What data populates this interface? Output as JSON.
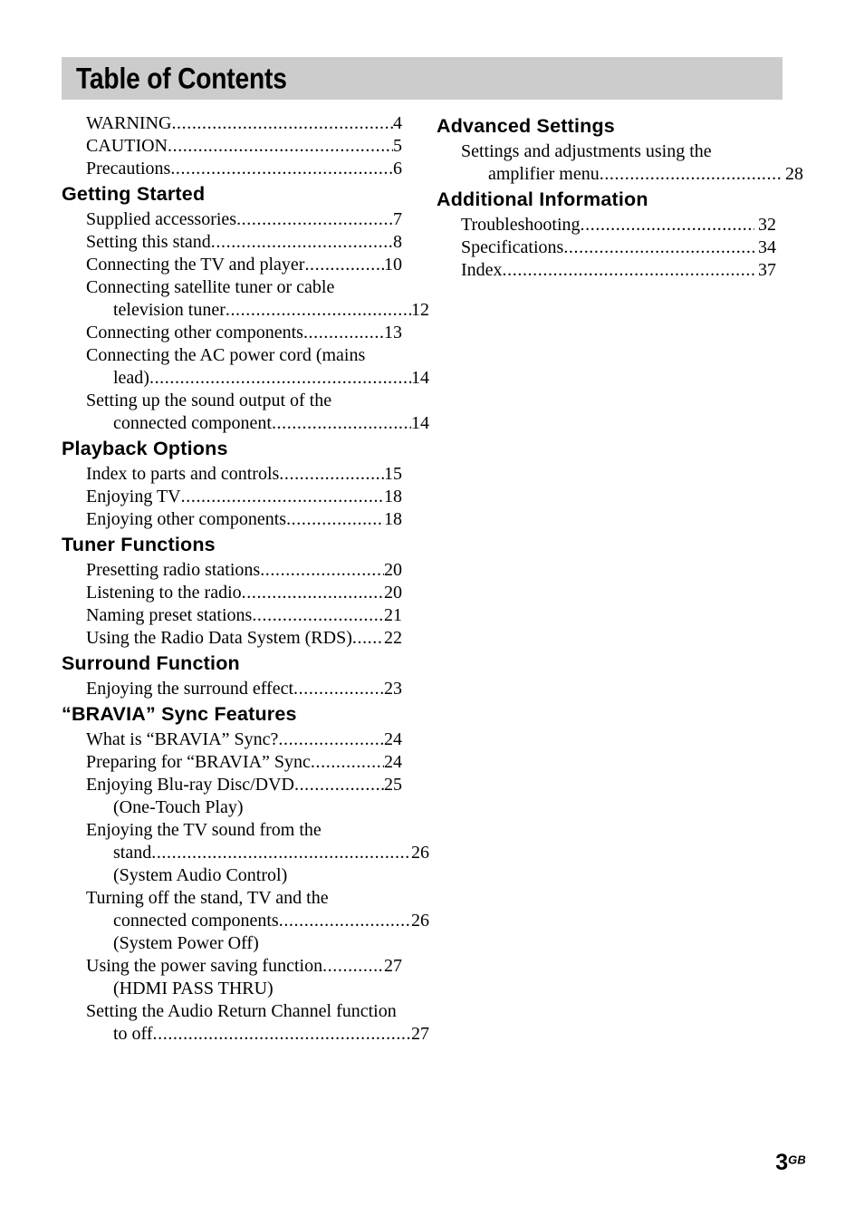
{
  "header": {
    "title": "Table of Contents",
    "banner_color": "#cccccc"
  },
  "footer": {
    "page_number": "3",
    "region_suffix": "GB"
  },
  "left_column": {
    "blocks": [
      {
        "type": "entries",
        "entries": [
          {
            "lines": [
              {
                "text": "WARNING",
                "leader": true,
                "page": "4"
              }
            ]
          },
          {
            "lines": [
              {
                "text": "CAUTION",
                "leader": true,
                "page": "5"
              }
            ]
          },
          {
            "lines": [
              {
                "text": "Precautions",
                "leader": true,
                "page": "6"
              }
            ]
          }
        ]
      },
      {
        "type": "heading",
        "label": "Getting Started"
      },
      {
        "type": "entries",
        "entries": [
          {
            "lines": [
              {
                "text": "Supplied accessories",
                "leader": true,
                "page": "7"
              }
            ]
          },
          {
            "lines": [
              {
                "text": "Setting this stand",
                "leader": true,
                "page": "8"
              }
            ]
          },
          {
            "lines": [
              {
                "text": "Connecting the TV and player",
                "leader": true,
                "page": "10"
              }
            ]
          },
          {
            "lines": [
              {
                "text": "Connecting satellite tuner or cable",
                "leader": false,
                "page": ""
              },
              {
                "text": "television tuner",
                "leader": true,
                "page": "12",
                "wrap": true
              }
            ]
          },
          {
            "lines": [
              {
                "text": "Connecting other components",
                "leader": true,
                "page": "13"
              }
            ]
          },
          {
            "lines": [
              {
                "text": "Connecting the AC power cord (mains",
                "leader": false,
                "page": ""
              },
              {
                "text": "lead)",
                "leader": true,
                "page": "14",
                "wrap": true
              }
            ]
          },
          {
            "lines": [
              {
                "text": "Setting up the sound output of the",
                "leader": false,
                "page": ""
              },
              {
                "text": "connected component",
                "leader": true,
                "page": "14",
                "wrap": true
              }
            ]
          }
        ]
      },
      {
        "type": "heading",
        "label": "Playback Options"
      },
      {
        "type": "entries",
        "entries": [
          {
            "lines": [
              {
                "text": "Index to parts and controls",
                "leader": true,
                "page": "15"
              }
            ]
          },
          {
            "lines": [
              {
                "text": "Enjoying TV",
                "leader": true,
                "page": "18"
              }
            ]
          },
          {
            "lines": [
              {
                "text": "Enjoying other components",
                "leader": true,
                "page": "18"
              }
            ]
          }
        ]
      },
      {
        "type": "heading",
        "label": "Tuner Functions"
      },
      {
        "type": "entries",
        "entries": [
          {
            "lines": [
              {
                "text": "Presetting radio stations",
                "leader": true,
                "page": "20"
              }
            ]
          },
          {
            "lines": [
              {
                "text": "Listening to the radio",
                "leader": true,
                "page": "20"
              }
            ]
          },
          {
            "lines": [
              {
                "text": "Naming preset stations",
                "leader": true,
                "page": "21"
              }
            ]
          },
          {
            "lines": [
              {
                "text": "Using the Radio Data System (RDS)",
                "leader": true,
                "page": "22"
              }
            ]
          }
        ]
      },
      {
        "type": "heading",
        "label": "Surround Function"
      },
      {
        "type": "entries",
        "entries": [
          {
            "lines": [
              {
                "text": "Enjoying the surround effect",
                "leader": true,
                "page": "23"
              }
            ]
          }
        ]
      },
      {
        "type": "heading",
        "label": "“BRAVIA” Sync Features"
      },
      {
        "type": "entries",
        "entries": [
          {
            "lines": [
              {
                "text": "What is “BRAVIA” Sync?",
                "leader": true,
                "page": "24"
              }
            ]
          },
          {
            "lines": [
              {
                "text": "Preparing for “BRAVIA” Sync",
                "leader": true,
                "page": "24"
              }
            ]
          },
          {
            "lines": [
              {
                "text": "Enjoying Blu-ray Disc/DVD",
                "leader": true,
                "page": "25"
              },
              {
                "text": "(One-Touch Play)",
                "leader": false,
                "page": "",
                "wrap": true
              }
            ]
          },
          {
            "lines": [
              {
                "text": "Enjoying the TV sound from the",
                "leader": false,
                "page": ""
              },
              {
                "text": "stand",
                "leader": true,
                "page": "26",
                "wrap": true
              },
              {
                "text": "(System Audio Control)",
                "leader": false,
                "page": "",
                "wrap": true
              }
            ]
          },
          {
            "lines": [
              {
                "text": "Turning off the stand, TV and the",
                "leader": false,
                "page": ""
              },
              {
                "text": "connected components",
                "leader": true,
                "page": "26",
                "wrap": true
              },
              {
                "text": "(System Power Off)",
                "leader": false,
                "page": "",
                "wrap": true
              }
            ]
          },
          {
            "lines": [
              {
                "text": "Using the power saving function",
                "leader": true,
                "page": "27"
              },
              {
                "text": "(HDMI PASS THRU)",
                "leader": false,
                "page": "",
                "wrap": true
              }
            ]
          },
          {
            "lines": [
              {
                "text": "Setting the Audio Return Channel function",
                "leader": false,
                "page": ""
              },
              {
                "text": "to off",
                "leader": true,
                "page": "27",
                "wrap": true
              }
            ]
          }
        ]
      }
    ]
  },
  "right_column": {
    "blocks": [
      {
        "type": "heading",
        "label": "Advanced Settings"
      },
      {
        "type": "entries",
        "entries": [
          {
            "lines": [
              {
                "text": "Settings and adjustments using the",
                "leader": false,
                "page": ""
              },
              {
                "text": "amplifier menu",
                "leader": true,
                "page": "28",
                "wrap": true
              }
            ]
          }
        ]
      },
      {
        "type": "heading",
        "label": "Additional Information"
      },
      {
        "type": "entries",
        "entries": [
          {
            "lines": [
              {
                "text": "Troubleshooting",
                "leader": true,
                "page": "32"
              }
            ]
          },
          {
            "lines": [
              {
                "text": "Specifications",
                "leader": true,
                "page": "34"
              }
            ]
          },
          {
            "lines": [
              {
                "text": "Index",
                "leader": true,
                "page": "37"
              }
            ]
          }
        ]
      }
    ]
  }
}
